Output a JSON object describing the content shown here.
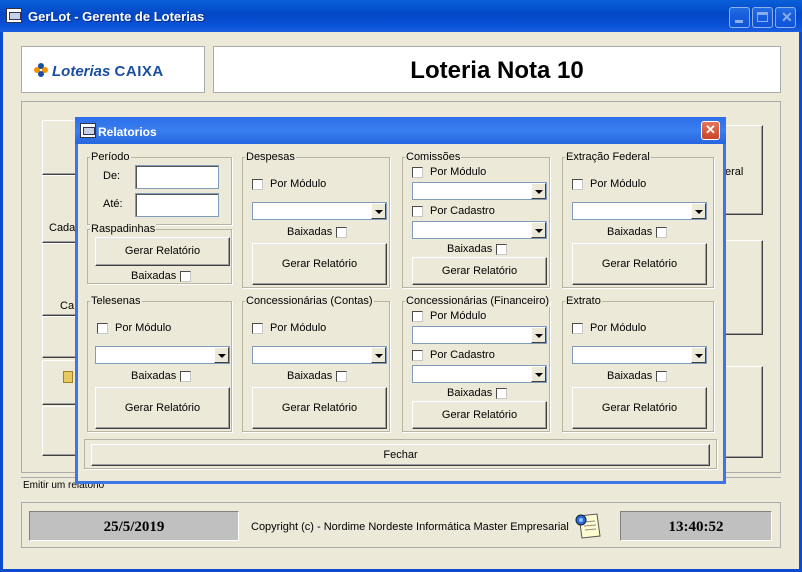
{
  "window": {
    "title": "GerLot - Gerente de Loterias"
  },
  "header": {
    "logo_text": "Loterias CAIXA",
    "logo_brand": "Loterias",
    "logo_caixa": "CAIXA",
    "game_title": "Loteria Nota 10"
  },
  "background": {
    "partial_labels": [
      "Cada",
      "Ca",
      "eral"
    ]
  },
  "status_bar": {
    "text": "Emitir um relatório"
  },
  "footer": {
    "date": "25/5/2019",
    "copyright": "Copyright (c) - Nordime Nordeste Informática Master Empresarial",
    "time": "13:40:52"
  },
  "dialog": {
    "title": "Relatorios",
    "periodo": {
      "label": "Período",
      "de_label": "De:",
      "ate_label": "Até:",
      "de_value": "",
      "ate_value": ""
    },
    "raspadinhas": {
      "label": "Raspadinhas",
      "button": "Gerar Relatório",
      "baixadas": "Baixadas"
    },
    "despesas": {
      "label": "Despesas",
      "por_modulo": "Por Módulo",
      "baixadas": "Baixadas",
      "button": "Gerar Relatório"
    },
    "comissoes": {
      "label": "Comissões",
      "por_modulo": "Por Módulo",
      "por_cadastro": "Por Cadastro",
      "baixadas": "Baixadas",
      "button": "Gerar Relatório"
    },
    "extracao_federal": {
      "label": "Extração Federal",
      "por_modulo": "Por Módulo",
      "baixadas": "Baixadas",
      "button": "Gerar Relatório"
    },
    "telesenas": {
      "label": "Telesenas",
      "por_modulo": "Por Módulo",
      "baixadas": "Baixadas",
      "button": "Gerar Relatório"
    },
    "concessionarias_contas": {
      "label": "Concessionárias (Contas)",
      "por_modulo": "Por Módulo",
      "baixadas": "Baixadas",
      "button": "Gerar Relatório"
    },
    "concessionarias_financeiro": {
      "label": "Concessionárias (Financeiro)",
      "por_modulo": "Por Módulo",
      "por_cadastro": "Por Cadastro",
      "baixadas": "Baixadas",
      "button": "Gerar Relatório"
    },
    "extrato": {
      "label": "Extrato",
      "por_modulo": "Por Módulo",
      "baixadas": "Baixadas",
      "button": "Gerar Relatório"
    },
    "fechar": "Fechar"
  },
  "colors": {
    "title_bar": "#0a52d8",
    "dialog_title": "#3a7ff0",
    "face": "#ece9d8",
    "close": "#c8442a"
  },
  "icons": [
    "app-icon",
    "minimize-icon",
    "maximize-icon",
    "close-icon",
    "clover-icon",
    "document-icon"
  ]
}
